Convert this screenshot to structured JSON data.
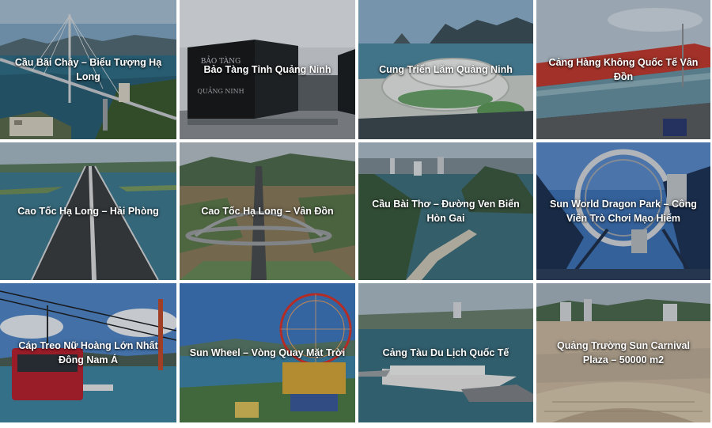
{
  "gallery": {
    "tiles": [
      {
        "title": "Cầu Bãi Cháy – Biểu Tượng Hạ Long"
      },
      {
        "title": "Bảo Tàng Tỉnh Quảng Ninh"
      },
      {
        "title": "Cung Triển Lãm Quảng Ninh"
      },
      {
        "title": "Cảng Hàng Không Quốc Tế Vân Đồn"
      },
      {
        "title": "Cao Tốc Hạ Long – Hải Phòng"
      },
      {
        "title": "Cao Tốc Hạ Long – Vân Đồn"
      },
      {
        "title": "Cầu Bài Thơ – Đường Ven Biển Hòn Gai"
      },
      {
        "title": "Sun World Dragon Park – Công Viên Trò Chơi Mạo Hiểm"
      },
      {
        "title": "Cáp Treo Nữ Hoàng Lớn Nhất Đông Nam Á"
      },
      {
        "title": "Sun Wheel – Vòng Quay Mặt Trời"
      },
      {
        "title": "Cảng Tàu Du Lịch Quốc Tế"
      },
      {
        "title": "Quảng Trường Sun Carnival Plaza – 50000 m2"
      }
    ],
    "museum_sign": "BẢO TÀNG QUẢNG NINH"
  }
}
